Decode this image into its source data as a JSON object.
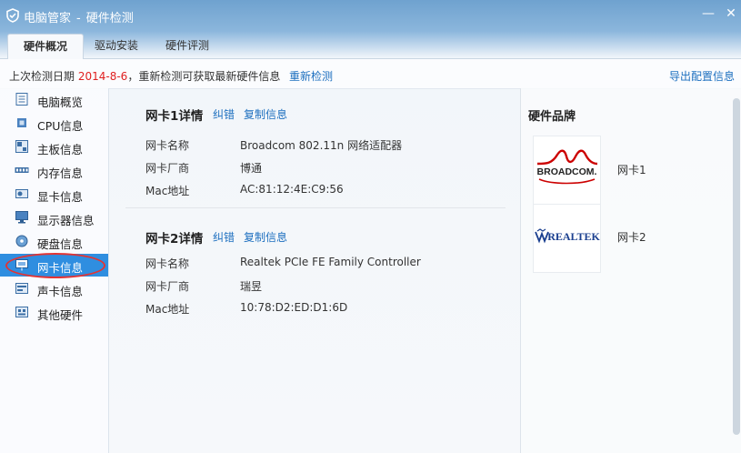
{
  "window": {
    "app_name": "电脑管家",
    "separator": "-",
    "section": "硬件检测",
    "min_glyph": "—",
    "close_glyph": "✕"
  },
  "tabs": [
    {
      "label": "硬件概况",
      "active": true
    },
    {
      "label": "驱动安装",
      "active": false
    },
    {
      "label": "硬件评测",
      "active": false
    }
  ],
  "info": {
    "prefix": "上次检测日期",
    "date": "2014-8-6",
    "suffix": "，重新检测可获取最新硬件信息",
    "recheck_link": "重新检测",
    "export_link": "导出配置信息"
  },
  "sidebar": {
    "items": [
      {
        "label": "电脑概览",
        "icon": "overview-icon"
      },
      {
        "label": "CPU信息",
        "icon": "cpu-icon"
      },
      {
        "label": "主板信息",
        "icon": "motherboard-icon"
      },
      {
        "label": "内存信息",
        "icon": "memory-icon"
      },
      {
        "label": "显卡信息",
        "icon": "gpu-icon"
      },
      {
        "label": "显示器信息",
        "icon": "monitor-icon"
      },
      {
        "label": "硬盘信息",
        "icon": "disk-icon"
      },
      {
        "label": "网卡信息",
        "icon": "network-icon",
        "active": true
      },
      {
        "label": "声卡信息",
        "icon": "sound-icon"
      },
      {
        "label": "其他硬件",
        "icon": "other-icon"
      }
    ]
  },
  "nics": [
    {
      "title": "网卡1详情",
      "correct_link": "纠错",
      "copy_link": "复制信息",
      "rows": [
        {
          "label": "网卡名称",
          "value": "Broadcom 802.11n 网络适配器"
        },
        {
          "label": "网卡厂商",
          "value": "博通"
        },
        {
          "label": "Mac地址",
          "value": "AC:81:12:4E:C9:56"
        }
      ]
    },
    {
      "title": "网卡2详情",
      "correct_link": "纠错",
      "copy_link": "复制信息",
      "rows": [
        {
          "label": "网卡名称",
          "value": "Realtek PCIe FE Family Controller"
        },
        {
          "label": "网卡厂商",
          "value": "瑞昱"
        },
        {
          "label": "Mac地址",
          "value": "10:78:D2:ED:D1:6D"
        }
      ]
    }
  ],
  "brand_panel": {
    "title": "硬件品牌",
    "brands": [
      {
        "logo_text": "BROADCOM.",
        "label": "网卡1"
      },
      {
        "logo_text": "REALTEK",
        "label": "网卡2"
      }
    ]
  },
  "colors": {
    "accent": "#2f8ee0",
    "link": "#1d6fbf",
    "date_red": "#e02020",
    "highlight_oval": "#e23434",
    "broadcom_red": "#cc0000",
    "realtek_blue": "#1a3f8f"
  }
}
